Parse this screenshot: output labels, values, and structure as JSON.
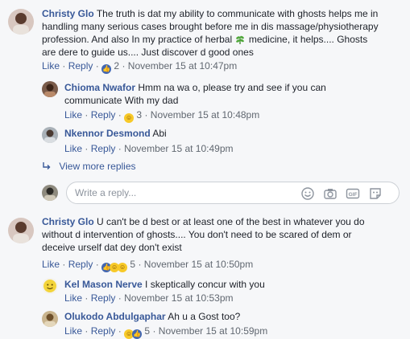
{
  "comments": [
    {
      "author": "Christy Glo",
      "lines": [
        "The truth is dat my ability to communicate with ghosts helps me in",
        "handling many serious cases brought before me in dis massage/physiotherapy",
        "profession. And also In my practice of herbal",
        "medicine, it helps.... Ghosts",
        "are dere to guide us.... Just discover d good ones"
      ],
      "like_label": "Like",
      "reply_label": "Reply",
      "reaction_count": "2",
      "timestamp": "November 15 at 10:47pm"
    },
    {
      "author": "Chioma Nwafor",
      "lines": [
        "Hmm na wa o, please try and see if you can",
        "communicate With my dad"
      ],
      "like_label": "Like",
      "reply_label": "Reply",
      "reaction_count": "3",
      "timestamp": "November 15 at 10:48pm"
    },
    {
      "author": "Nkennor Desmond",
      "lines": [
        "Abi"
      ],
      "like_label": "Like",
      "reply_label": "Reply",
      "timestamp": "November 15 at 10:49pm"
    },
    {
      "author": "Christy Glo",
      "lines": [
        "U can't be d best or at least one of the best in whatever you do",
        "without d intervention of ghosts.... You don't need to be scared of dem or",
        "deceive urself dat dey don't exist"
      ],
      "like_label": "Like",
      "reply_label": "Reply",
      "reaction_count": "5",
      "timestamp": "November 15 at 10:50pm"
    },
    {
      "author": "Kel Mason Nerve",
      "lines": [
        "I skeptically concur with you"
      ],
      "like_label": "Like",
      "reply_label": "Reply",
      "timestamp": "November 15 at 10:53pm"
    },
    {
      "author": "Olukodo Abdulgaphar",
      "lines": [
        "Ah u a Gost too?"
      ],
      "like_label": "Like",
      "reply_label": "Reply",
      "reaction_count": "5",
      "timestamp": "November 15 at 10:59pm"
    }
  ],
  "view_more_replies": "View more replies",
  "reply_box": {
    "placeholder": "Write a reply..."
  },
  "separator": "·",
  "icons": [
    "smiley-icon",
    "camera-icon",
    "gif-icon",
    "sticker-icon",
    "herb-emoji-icon"
  ],
  "colors": {
    "link": "#385898",
    "meta": "#606770",
    "like_reaction": "#4267b2",
    "background": "#f6f7f9"
  }
}
